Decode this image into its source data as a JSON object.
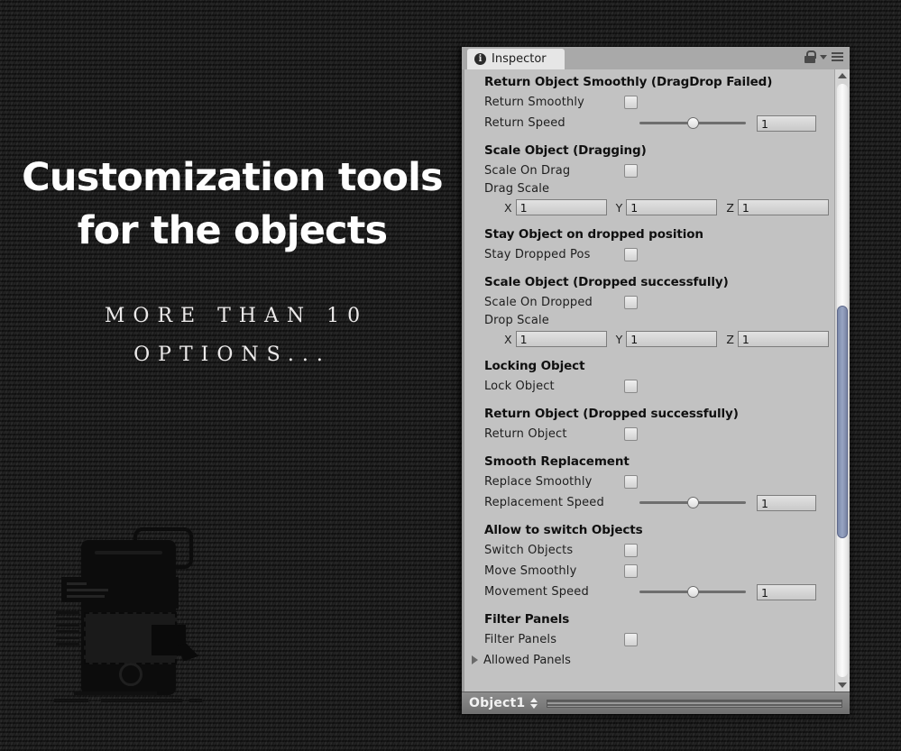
{
  "promo": {
    "headline": "Customization tools\nfor the objects",
    "subline": "MORE THAN 10\nOPTIONS...",
    "illustration_name": "phone-drag-drop-illustration"
  },
  "inspector": {
    "tab_label": "Inspector",
    "tab_icon": "info-icon",
    "lock_icon": "lock-icon",
    "menu_icon": "menu-icon",
    "caret_icon": "chevron-down-icon",
    "footer": {
      "object_name": "Object1",
      "stepper_icon": "up-down-stepper-icon"
    },
    "scrollbar": {
      "up_arrow": "scroll-up-arrow-icon",
      "down_arrow": "scroll-down-arrow-icon"
    },
    "groups": [
      {
        "title": "Return Object Smoothly (DragDrop Failed)",
        "rows": [
          {
            "kind": "toggle",
            "label": "Return Smoothly",
            "checked": false
          },
          {
            "kind": "slider",
            "label": "Return Speed",
            "value": "1",
            "fill": 45
          }
        ]
      },
      {
        "title": "Scale Object (Dragging)",
        "rows": [
          {
            "kind": "toggle",
            "label": "Scale On Drag",
            "checked": false
          },
          {
            "kind": "vector",
            "label": "Drag Scale",
            "x": "1",
            "y": "1",
            "z": "1",
            "axis_x": "X",
            "axis_y": "Y",
            "axis_z": "Z"
          }
        ]
      },
      {
        "title": "Stay Object on dropped position",
        "rows": [
          {
            "kind": "toggle",
            "label": "Stay Dropped Pos",
            "checked": false
          }
        ]
      },
      {
        "title": "Scale Object (Dropped successfully)",
        "rows": [
          {
            "kind": "toggle",
            "label": "Scale On Dropped",
            "checked": false
          },
          {
            "kind": "vector",
            "label": "Drop Scale",
            "x": "1",
            "y": "1",
            "z": "1",
            "axis_x": "X",
            "axis_y": "Y",
            "axis_z": "Z"
          }
        ]
      },
      {
        "title": "Locking Object",
        "rows": [
          {
            "kind": "toggle",
            "label": "Lock Object",
            "checked": false
          }
        ]
      },
      {
        "title": "Return Object (Dropped successfully)",
        "rows": [
          {
            "kind": "toggle",
            "label": "Return Object",
            "checked": false
          }
        ]
      },
      {
        "title": "Smooth Replacement",
        "rows": [
          {
            "kind": "toggle",
            "label": "Replace Smoothly",
            "checked": false
          },
          {
            "kind": "slider",
            "label": "Replacement Speed",
            "value": "1",
            "fill": 45
          }
        ]
      },
      {
        "title": "Allow to switch Objects",
        "rows": [
          {
            "kind": "toggle",
            "label": "Switch Objects",
            "checked": false
          },
          {
            "kind": "toggle",
            "label": "Move Smoothly",
            "checked": false
          },
          {
            "kind": "slider",
            "label": "Movement Speed",
            "value": "1",
            "fill": 45
          }
        ]
      },
      {
        "title": "Filter Panels",
        "rows": [
          {
            "kind": "toggle",
            "label": "Filter Panels",
            "checked": false
          },
          {
            "kind": "foldout",
            "label": "Allowed Panels",
            "expanded": false
          }
        ]
      }
    ]
  }
}
